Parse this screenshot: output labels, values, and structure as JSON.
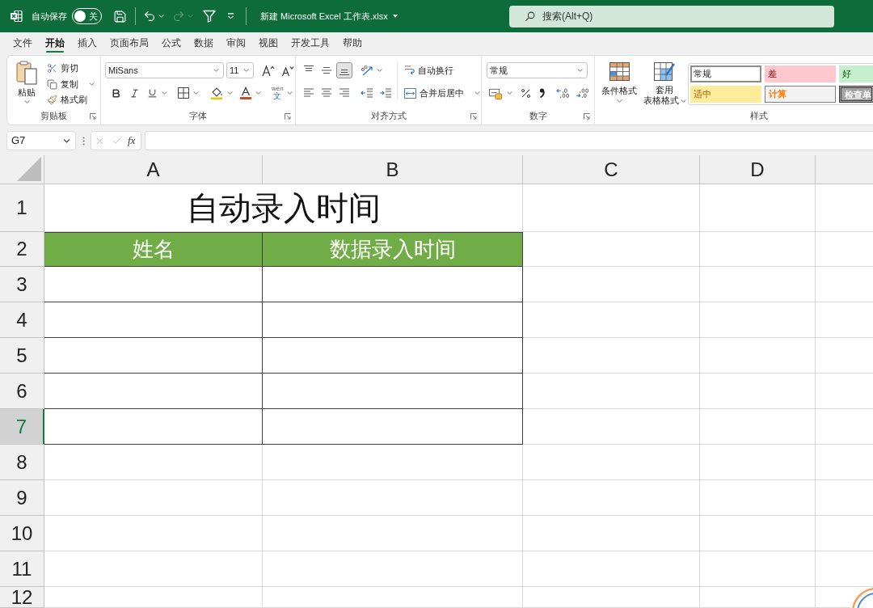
{
  "title_bar": {
    "autosave": {
      "label": "自动保存",
      "on": false,
      "toggle_text": "关"
    },
    "undo": {
      "disabled": false
    },
    "redo": {
      "disabled": true
    },
    "filename": "新建 Microsoft Excel 工作表.xlsx",
    "search": {
      "placeholder": "搜索(Alt+Q)"
    }
  },
  "tabs": [
    {
      "label": "文件",
      "selected": false
    },
    {
      "label": "开始",
      "selected": true
    },
    {
      "label": "插入",
      "selected": false
    },
    {
      "label": "页面布局",
      "selected": false
    },
    {
      "label": "公式",
      "selected": false
    },
    {
      "label": "数据",
      "selected": false
    },
    {
      "label": "审阅",
      "selected": false
    },
    {
      "label": "视图",
      "selected": false
    },
    {
      "label": "开发工具",
      "selected": false
    },
    {
      "label": "帮助",
      "selected": false
    }
  ],
  "ribbon": {
    "clipboard": {
      "label": "剪贴板",
      "paste": "粘贴",
      "cut": "剪切",
      "copy": "复制",
      "format_painter": "格式刷"
    },
    "font": {
      "label": "字体",
      "font_name": "MiSans",
      "font_size": "11",
      "phonetic": [
        "wén",
        "文"
      ]
    },
    "alignment": {
      "label": "对齐方式",
      "vertical_align": [
        {
          "kind": "top",
          "selected": false
        },
        {
          "kind": "middle",
          "selected": false
        },
        {
          "kind": "bottom",
          "selected": true
        }
      ],
      "horizontal_align": [
        {
          "kind": "left",
          "selected": false
        },
        {
          "kind": "center",
          "selected": false
        },
        {
          "kind": "right",
          "selected": false
        }
      ],
      "wrap_text": "自动换行",
      "merge_center": "合并后居中"
    },
    "number": {
      "label": "数字",
      "format": "常规"
    },
    "styles": {
      "label": "样式",
      "conditional_formatting": "条件格式",
      "format_as_table": [
        "套用",
        "表格格式"
      ],
      "cell_styles": [
        {
          "label": "常规",
          "kind": "normal",
          "selected": true
        },
        {
          "label": "差",
          "kind": "bad",
          "selected": false
        },
        {
          "label": "好",
          "kind": "good",
          "selected": false
        },
        {
          "label": "适中",
          "kind": "neutral",
          "selected": false
        },
        {
          "label": "计算",
          "kind": "calculation",
          "selected": false
        },
        {
          "label": "检查单",
          "kind": "check",
          "selected": false
        }
      ]
    }
  },
  "formula_bar": {
    "name_box": "G7",
    "insert_function": "fx"
  },
  "sheet": {
    "columns": [
      "A",
      "B",
      "C",
      "D"
    ],
    "rows": [
      {
        "label": "1",
        "selected": false
      },
      {
        "label": "2",
        "selected": false
      },
      {
        "label": "3",
        "selected": false
      },
      {
        "label": "4",
        "selected": false
      },
      {
        "label": "5",
        "selected": false
      },
      {
        "label": "6",
        "selected": false
      },
      {
        "label": "7",
        "selected": true
      },
      {
        "label": "8",
        "selected": false
      },
      {
        "label": "9",
        "selected": false
      },
      {
        "label": "10",
        "selected": false
      },
      {
        "label": "11",
        "selected": false
      },
      {
        "label": "12",
        "selected": false
      }
    ],
    "title": "自动录入时间",
    "headers": [
      "姓名",
      "数据录入时间"
    ]
  }
}
